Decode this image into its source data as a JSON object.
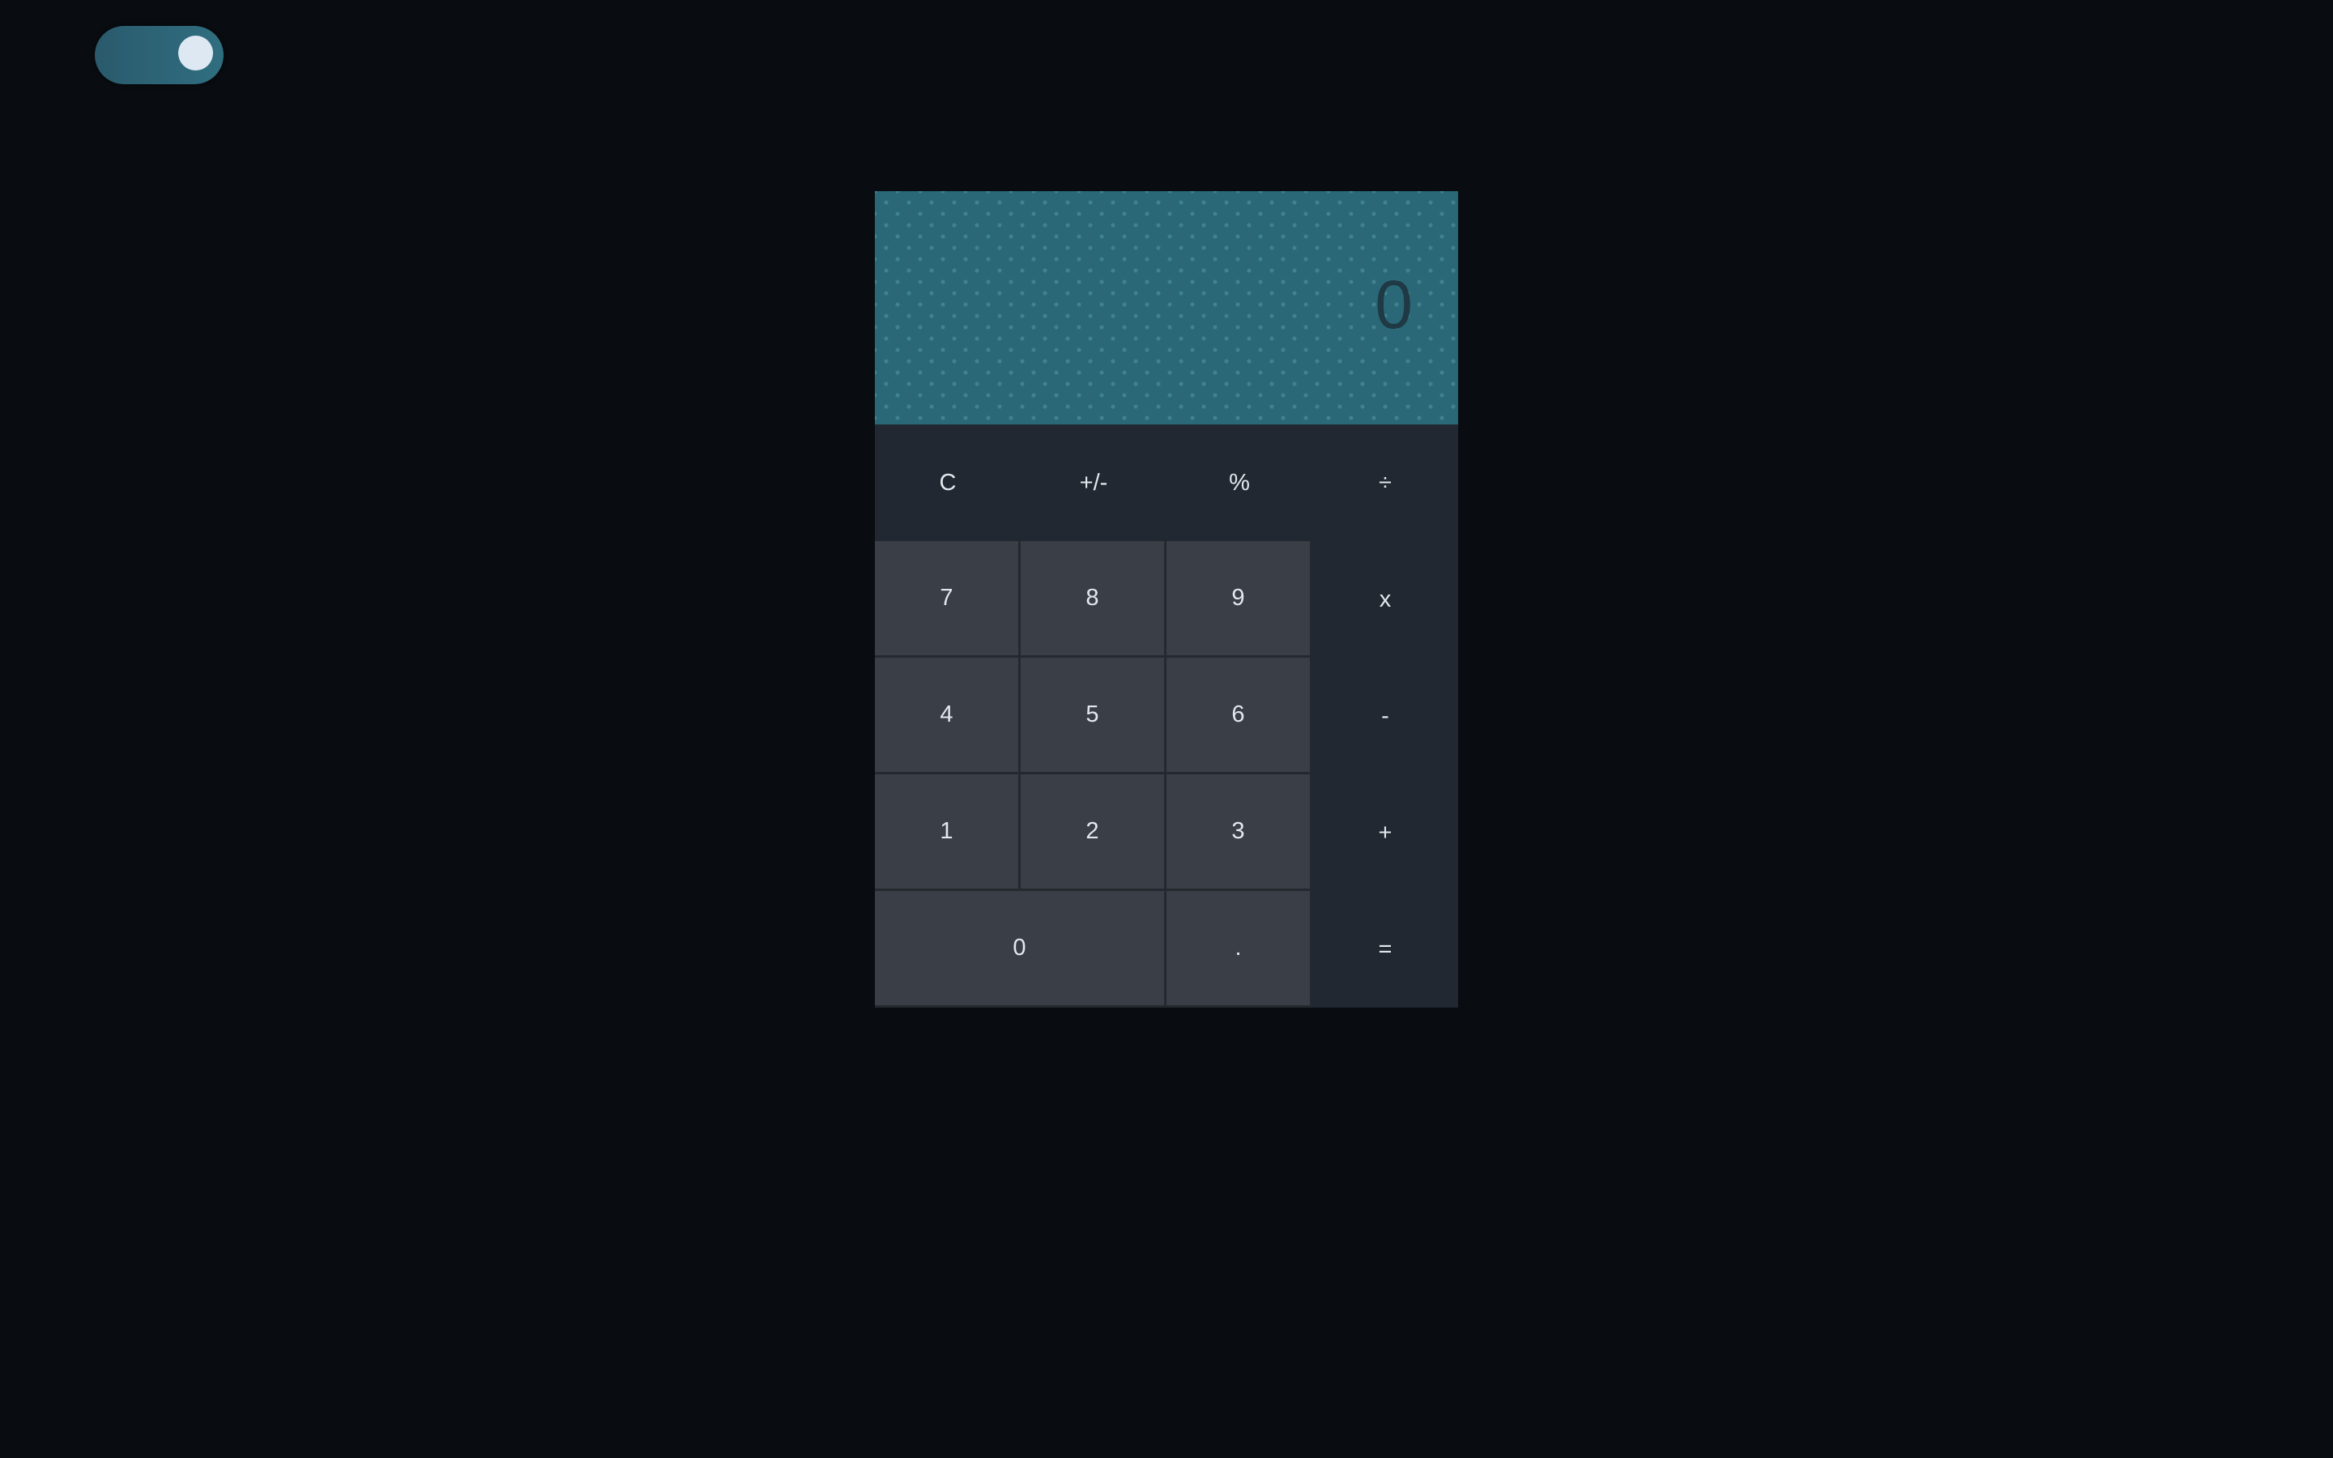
{
  "display": {
    "value": "0"
  },
  "theme_toggle": {
    "state": "on"
  },
  "keys": {
    "clear": "C",
    "sign": "+/-",
    "percent": "%",
    "divide": "÷",
    "seven": "7",
    "eight": "8",
    "nine": "9",
    "multiply": "x",
    "four": "4",
    "five": "5",
    "six": "6",
    "subtract": "-",
    "one": "1",
    "two": "2",
    "three": "3",
    "add": "+",
    "zero": "0",
    "decimal": ".",
    "equals": "="
  },
  "colors": {
    "background": "#090c10",
    "display": "#2a6878",
    "keypad": "#222831",
    "number_key": "#393e47",
    "accent": "#2f6e80"
  }
}
